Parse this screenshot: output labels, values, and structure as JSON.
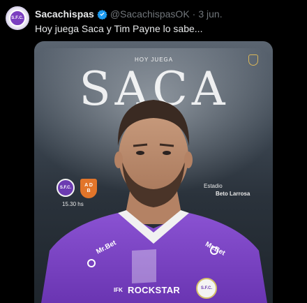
{
  "tweet": {
    "display_name": "Sacachispas",
    "handle": "@SacachispasOK",
    "separator": "·",
    "time": "3 jun.",
    "text": "Hoy juega Saca y Tim Payne lo sabe..."
  },
  "avatar": {
    "crest_text": "S.F.C."
  },
  "media": {
    "pre_title": "HOY JUEGA",
    "title": "SACA",
    "home_logo_text": "S.F.C.",
    "away_logo_text": "A D\nB",
    "kickoff": "15.30 hs",
    "stadium_label": "Estadio",
    "stadium_name": "Beto Larrosa",
    "sponsors": {
      "mrbet_left": "Mr.Bet",
      "mrbet_right": "Mr.Bet",
      "ifk": "IFK",
      "rockstar": "ROCKSTAR"
    },
    "shirt_crest_text": "S.F.C."
  },
  "colors": {
    "background": "#000000",
    "text_primary": "#e7e9ea",
    "text_secondary": "#71767b",
    "verified_blue": "#1d9bf0",
    "jersey_purple": "#7a45c4",
    "away_orange": "#e2752a"
  },
  "icons": {
    "verified": "verified-badge-icon"
  }
}
